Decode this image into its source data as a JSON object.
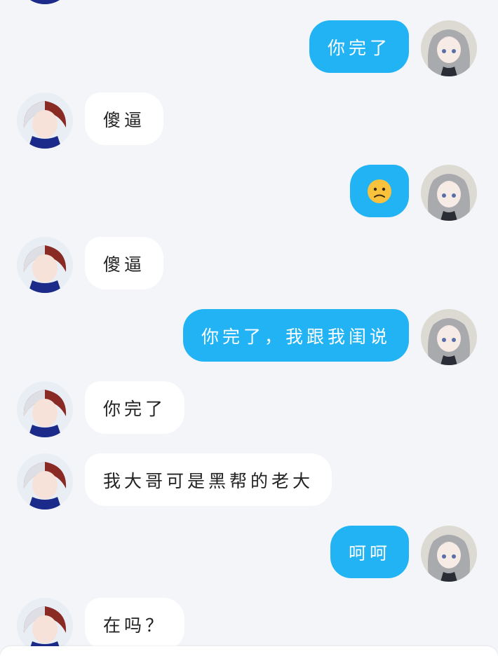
{
  "messages": [
    {
      "side": "right",
      "text": "你完了"
    },
    {
      "side": "left",
      "text": "傻逼"
    },
    {
      "side": "right",
      "text": "",
      "emoji": "confused-face-emoji"
    },
    {
      "side": "left",
      "text": "傻逼"
    },
    {
      "side": "right",
      "text": "你完了，我跟我闺说"
    },
    {
      "side": "left",
      "text": "你完了"
    },
    {
      "side": "left",
      "text": "我大哥可是黑帮的老大"
    },
    {
      "side": "right",
      "text": "呵呵"
    },
    {
      "side": "left",
      "text": "在吗？"
    }
  ],
  "colors": {
    "background": "#f3f5f8",
    "outgoing_bubble": "#22b3f5",
    "incoming_bubble": "#ffffff",
    "outgoing_text": "#ffffff",
    "incoming_text": "#222222"
  },
  "avatars": {
    "left": "boy-avatar-red-white-hair",
    "right": "girl-avatar-silver-hair"
  }
}
